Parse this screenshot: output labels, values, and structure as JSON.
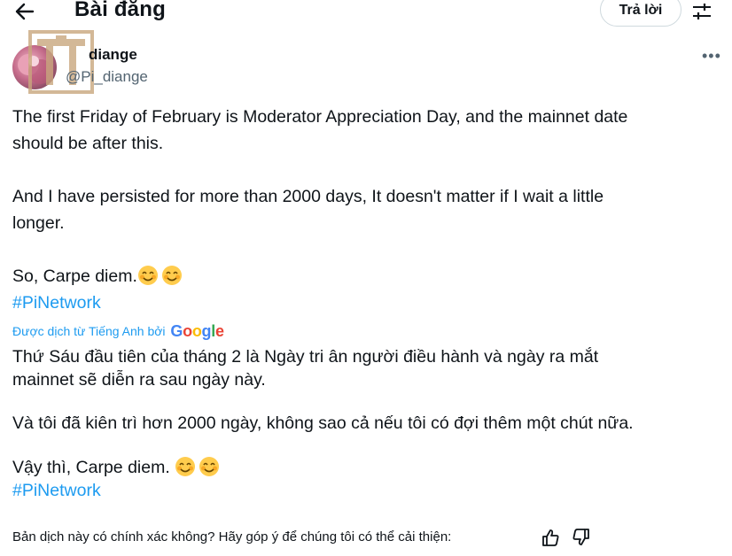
{
  "header": {
    "title": "Bài đăng",
    "reply_label": "Trả lời",
    "back_icon": "arrow-left-icon",
    "tune_icon": "sliders-icon"
  },
  "post": {
    "author_name": "diange",
    "author_handle": "@Pi_diange",
    "more_label": "•••",
    "original": {
      "p1_line1": "The first Friday of February is Moderator Appreciation Day, and the mainnet date",
      "p1_line2": "should be after this.",
      "p2_line1": "And I have persisted for more than 2000 days,  It doesn't matter if I wait a little",
      "p2_line2": "longer.",
      "p3": "So, Carpe diem.",
      "hashtag": "#PiNetwork"
    },
    "translation_note": "Được dịch từ Tiếng Anh bởi",
    "translation_brand": "Google",
    "translated": {
      "p1_line1": "Thứ Sáu đầu tiên của tháng 2 là Ngày tri ân người điều hành và ngày ra mắt",
      "p1_line2": "mainnet sẽ diễn ra sau ngày này.",
      "p2": "Và tôi đã kiên trì hơn 2000 ngày, không sao cả nếu tôi có đợi thêm một chút nữa.",
      "p3": "Vậy thì, Carpe diem. ",
      "hashtag": "#PiNetwork"
    },
    "feedback_question": "Bản dịch này có chính xác không? Hãy góp ý để chúng tôi có thể cải thiện:"
  },
  "colors": {
    "link": "#1d9bf0",
    "muted": "#536471",
    "text": "#0f1419",
    "border": "#cfd9de"
  }
}
